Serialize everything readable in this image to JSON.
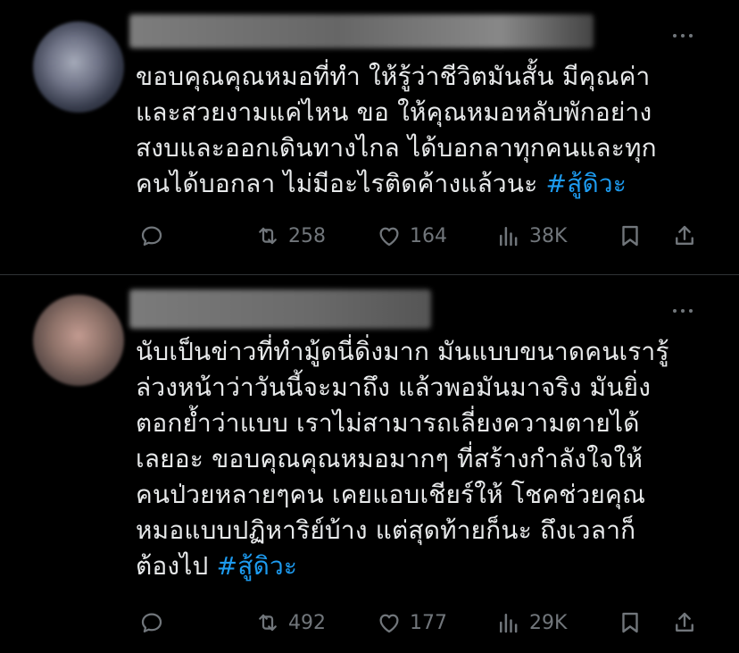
{
  "posts": [
    {
      "lines": [
        "ขอบคุณคุณหมอที่ทำ ให้รู้ว่าชีวิตมันสั้น มีคุณค่า",
        "และสวยงามแค่ไหน ขอ ให้คุณหมอหลับพักอย่าง",
        "สงบและออกเดินทางไกล ได้บอกลาทุกคนและทุก",
        "คนได้บอกลา ไม่มีอะไรติดค้างแล้วนะ "
      ],
      "hashtag": "#สู้ดิวะ",
      "retweets": "258",
      "likes": "164",
      "views": "38K"
    },
    {
      "lines": [
        "นับเป็นข่าวที่ทำมู้ดนี่ดิ่งมาก มันแบบขนาดคนเรารู้",
        "ล่วงหน้าว่าวันนี้จะมาถึง แล้วพอมันมาจริง มันยิ่ง",
        "ตอกย้ำว่าแบบ เราไม่สามารถเลี่ยงความตายได้",
        "เลยอะ ขอบคุณคุณหมอมากๆ ที่สร้างกำลังใจให้",
        "คนป่วยหลายๆคน เคยแอบเชียร์ให้ โชคช่วยคุณ",
        "หมอแบบปฏิหาริย์บ้าง แต่สุดท้ายก็นะ ถึงเวลาก็",
        "ต้องไป "
      ],
      "hashtag": "#สู้ดิวะ",
      "retweets": "492",
      "likes": "177",
      "views": "29K"
    }
  ],
  "icons": {
    "reply": "reply-icon",
    "retweet": "retweet-icon",
    "like": "heart-icon",
    "views": "views-icon",
    "bookmark": "bookmark-icon",
    "share": "share-icon",
    "more": "more-icon"
  },
  "colors": {
    "background": "#000000",
    "text": "#e7e9ea",
    "muted": "#71767b",
    "hashtag": "#1d9bf0",
    "divider": "#2f3336"
  }
}
